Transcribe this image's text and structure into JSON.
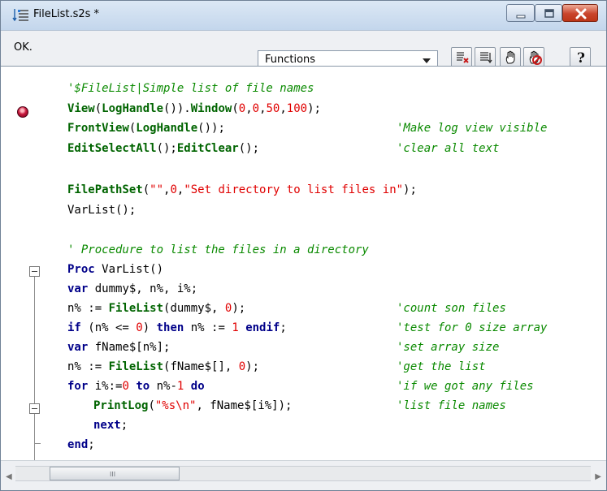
{
  "window": {
    "title": "FileList.s2s *",
    "app_icon": "script-list-icon",
    "controls": [
      "minimize-icon",
      "maximize-icon",
      "close-icon"
    ]
  },
  "toolbar": {
    "status": "OK.",
    "functions_dropdown": {
      "selected": "Functions",
      "arrow": "chevron-down-icon"
    },
    "buttons": [
      "clear-breakpoints-icon",
      "list-icon",
      "hand-icon",
      "stop-hand-icon",
      "help-icon"
    ],
    "help_label": "?"
  },
  "editor": {
    "lines": [
      {
        "kind": "comment",
        "text": "'$FileList|Simple list of file names"
      },
      {
        "kind": "code",
        "text": "View(LogHandle()).Window(0,0,50,100);"
      },
      {
        "kind": "code",
        "text": "FrontView(LogHandle());",
        "comment": "'Make log view visible"
      },
      {
        "kind": "code",
        "text": "EditSelectAll();EditClear();",
        "comment": "'clear all text"
      },
      {
        "kind": "code",
        "text": "FilePathSet(\"\",0,\"Set directory to list files in\");"
      },
      {
        "kind": "code",
        "text": "VarList();"
      },
      {
        "kind": "comment",
        "text": "' Procedure to list the files in a directory"
      },
      {
        "kind": "code",
        "text": "Proc VarList()"
      },
      {
        "kind": "code",
        "text": "var dummy$, n%, i%;"
      },
      {
        "kind": "code",
        "text": "n% := FileList(dummy$, 0);",
        "comment": "'count son files"
      },
      {
        "kind": "code",
        "text": "if (n% <= 0) then n% := 1 endif;",
        "comment": "'test for 0 size array"
      },
      {
        "kind": "code",
        "text": "var fName$[n%];",
        "comment": "'set array size"
      },
      {
        "kind": "code",
        "text": "n% := FileList(fName$[], 0);",
        "comment": "'get the list"
      },
      {
        "kind": "code",
        "text": "for i%:=0 to n%-1 do",
        "comment": "'if we got any files"
      },
      {
        "kind": "code",
        "text": "PrintLog(\"%s\\n\", fName$[i%]);",
        "comment": "'list file names"
      },
      {
        "kind": "code",
        "text": "next;"
      },
      {
        "kind": "code",
        "text": "end;"
      }
    ]
  },
  "scrollbar": {
    "left_arrow": "chevron-left-icon",
    "right_arrow": "chevron-right-icon",
    "grip": "III"
  },
  "colors": {
    "keyword": "#000089",
    "function": "#006400",
    "number": "#e00000",
    "comment": "#0a8a00",
    "breakpoint": "#c7193d"
  }
}
